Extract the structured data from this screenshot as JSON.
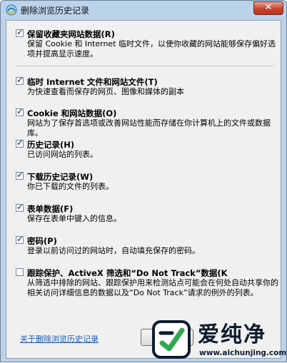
{
  "window": {
    "title": "删除浏览历史记录",
    "close_label": "✕",
    "accent_color": "#1a5bb5"
  },
  "options": [
    {
      "checked": true,
      "label": "保留收藏夹网站数据(R)",
      "desc": "保留 Cookie 和 Internet 临时文件，以使你收藏的网站能够保存偏好选项并提高显示速度。"
    },
    {
      "checked": true,
      "label": "临时 Internet 文件和网站文件(T)",
      "desc": "为快速查看而保存的网页、图像和媒体的副本"
    },
    {
      "checked": true,
      "label": "Cookie 和网站数据(O)",
      "desc": "网站为了保存首选项或改善网站性能而存储在你计算机上的文件或数据库。"
    },
    {
      "checked": true,
      "label": "历史记录(H)",
      "desc": "已访问网站的列表。"
    },
    {
      "checked": true,
      "label": "下载历史记录(W)",
      "desc": "你已下载的文件的列表。"
    },
    {
      "checked": true,
      "label": "表单数据(F)",
      "desc": "保存在表单中键入的信息。"
    },
    {
      "checked": true,
      "label": "密码(P)",
      "desc": "登录以前访问过的网站时，自动填充保存的密码。"
    },
    {
      "checked": false,
      "label": "跟踪保护、ActiveX 筛选和“Do Not Track”数据(K",
      "desc": "从筛选中排除的网站、跟踪保护用来检测站点可能会在何处自动共享你的相关访问详细信息的数据以及“Do Not Track”请求的例外的列表。"
    }
  ],
  "footer": {
    "about_link": "关于删除浏览历史记录"
  },
  "watermark": {
    "brand": "爱纯净",
    "url": "www.aichunjing.com"
  }
}
